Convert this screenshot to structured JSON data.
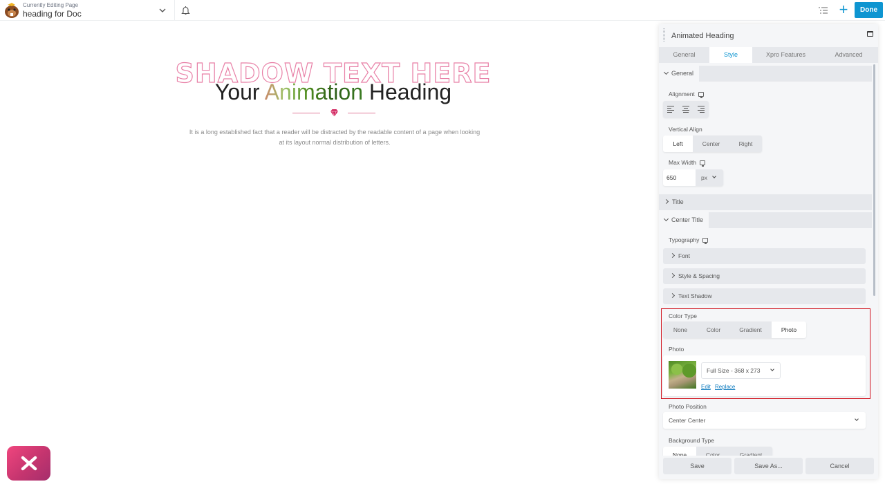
{
  "topbar": {
    "editing_label": "Currently Editing Page",
    "page_title": "heading for Doc",
    "done_label": "Done",
    "plus_label": "+"
  },
  "canvas": {
    "shadow_text": "SHADOW TEXT HERE",
    "heading_before": "Your ",
    "heading_highlight": "Animation",
    "heading_after": " Heading",
    "description": "It is a long established fact that a reader will be distracted by the readable content of a page when looking at its layout normal distribution of letters."
  },
  "panel": {
    "title": "Animated Heading",
    "tabs": [
      {
        "label": "General",
        "active": false
      },
      {
        "label": "Style",
        "active": true
      },
      {
        "label": "Xpro Features",
        "active": false
      },
      {
        "label": "Advanced",
        "active": false
      }
    ],
    "sections": {
      "general": "General",
      "title": "Title",
      "center_title": "Center Title"
    },
    "alignment_label": "Alignment",
    "vertical_align": {
      "label": "Vertical Align",
      "options": [
        "Left",
        "Center",
        "Right"
      ],
      "selected": "Left"
    },
    "max_width": {
      "label": "Max Width",
      "value": "650",
      "unit": "px"
    },
    "typography": {
      "label": "Typography",
      "items": [
        "Font",
        "Style & Spacing",
        "Text Shadow"
      ]
    },
    "color_type": {
      "label": "Color Type",
      "options": [
        "None",
        "Color",
        "Gradient",
        "Photo"
      ],
      "selected": "Photo"
    },
    "photo": {
      "label": "Photo",
      "size_option": "Full Size - 368 x 273",
      "edit_label": "Edit",
      "replace_label": "Replace"
    },
    "photo_position": {
      "label": "Photo Position",
      "value": "Center Center"
    },
    "background_type": {
      "label": "Background Type",
      "options": [
        "None",
        "Color",
        "Gradient"
      ]
    },
    "footer": {
      "save": "Save",
      "save_as": "Save As...",
      "cancel": "Cancel"
    }
  },
  "colors": {
    "accent": "#0e95d1",
    "highlight_border": "#d0101b",
    "shadow_text_stroke": "#e87fa6",
    "fab": "#e03f7c"
  }
}
